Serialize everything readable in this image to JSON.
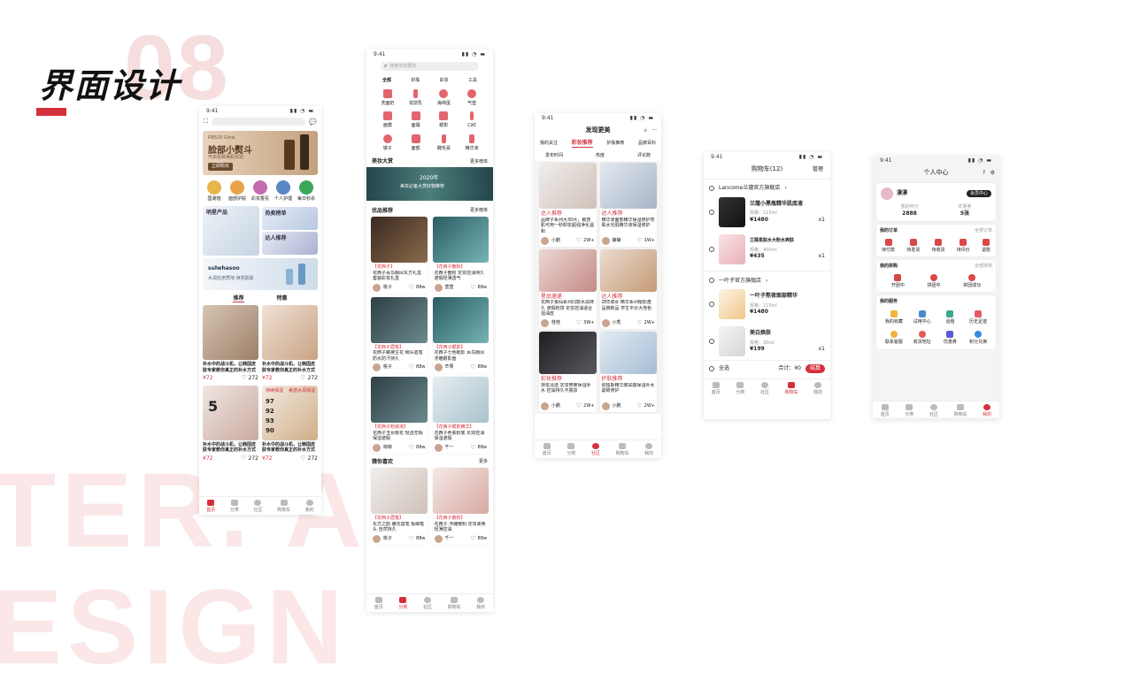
{
  "header": {
    "title": "界面设计",
    "number": "08",
    "watermark_1": "TER. AI",
    "watermark_2": "ESIGN"
  },
  "colors": {
    "accent": "#d4303c",
    "watermark": "#fbe7e7"
  },
  "p1": {
    "time": "9:41",
    "banner_tag": "RB520 Glow",
    "banner_title": "脸部小熨斗",
    "banner_sub": "开启极致美肌体验",
    "banner_btn": "立即购买",
    "cats": [
      "国潮馆",
      "面部护肤",
      "彩妆香氛",
      "个人护理",
      "每日秒杀"
    ],
    "promo_left": "明星产品",
    "promo_hot": "热卖榜单",
    "promo_kol": "达人推荐",
    "brand_name": "sulwhasoo",
    "brand_sub": "水润抗老质地 焕亮肌肤",
    "tabs": [
      "推荐",
      "特惠"
    ],
    "products": [
      {
        "title": "补水中的战斗机，让韩国皮肤专家教你真正的补水方式",
        "price": "¥72",
        "likes": "272"
      },
      {
        "title": "补水中的战斗机，让韩国皮肤专家教你真正的补水方式",
        "price": "¥72",
        "likes": "272"
      },
      {
        "title": "补水中的战斗机，让韩国皮肤专家教你真正的补水方式",
        "price": "¥72",
        "likes": "272"
      },
      {
        "title": "补水中的战斗机，让韩国皮肤专家教你真正的补水方式",
        "price": "¥72",
        "likes": "272"
      }
    ],
    "img2_lines": [
      "持续保湿",
      "美透水润保湿"
    ],
    "img2_nums": [
      "97",
      "92",
      "93",
      "90"
    ],
    "img1_num": "5",
    "nav": [
      "首页",
      "分类",
      "社区",
      "购物车",
      "我的"
    ]
  },
  "p2": {
    "time": "9:41",
    "search_placeholder": "搜索你想要的",
    "tabs": [
      "全部",
      "护肤",
      "彩妆",
      "工具"
    ],
    "icons": [
      "洗面奶",
      "妆前乳",
      "海绵蛋",
      "气垫",
      "面膜",
      "面霜",
      "眼影",
      "口红",
      "镜子",
      "面部",
      "睫毛膏",
      "精华液"
    ],
    "section_contest": "美妆大赏",
    "section_more": "更多榜单",
    "banner_year": "2020年",
    "banner_text": "美妆必备大赏好物推荐",
    "section_picks": "优品推荐",
    "picks_more": "更多榜单",
    "posts": [
      {
        "tag": "【花西子】",
        "text": "花西子百鸟朝凤东方礼盒套装彩妆礼盒",
        "user": "桃子",
        "likes": "88w"
      },
      {
        "tag": "【花西子散粉】",
        "text": "花西子散粉 定妆控油持久遮瑕轻薄透气",
        "user": "萱萱",
        "likes": "88w"
      },
      {
        "tag": "【花西子眉笔】",
        "text": "花西子螺黛生花 细头眉笔防水防汗持久",
        "user": "桃子",
        "likes": "88w"
      },
      {
        "tag": "【花西子眼影】",
        "text": "花西子七色眼影 百鸟朝凤浮雕眼影盘",
        "user": "芒果",
        "likes": "88w"
      },
      {
        "tag": "【花西子粉底液】",
        "text": "花西子玉女桃花 轻透无瑕 保湿遮瑕",
        "user": "柳柳",
        "likes": "88w"
      },
      {
        "tag": "【花西子眼影精华】",
        "text": "花西子养肤粉底 长效控油 保湿遮瑕",
        "user": "千一",
        "likes": "88w"
      },
      {
        "tag": "【花西子眉笔】",
        "text": "东方之韵 雕花眉笔 极细笔头 自然持久",
        "user": "桃子",
        "likes": "88w"
      },
      {
        "tag": "【花西子散粉】",
        "text": "花西子 浮雕散粉 定妆柔焦 轻薄控油",
        "user": "千一",
        "likes": "88w"
      }
    ],
    "section_guess": "猜你喜欢",
    "guess_more": "更多",
    "nav": [
      "首页",
      "分类",
      "社区",
      "购物车",
      "我的"
    ]
  },
  "p3": {
    "time": "9:41",
    "title": "发现更美",
    "tabs": [
      "我的关注",
      "彩妆推荐",
      "护肤推荐",
      "品牌百科"
    ],
    "filters": [
      "发布时间",
      "热度",
      "评论数"
    ],
    "posts": [
      {
        "tag": "达人推荐",
        "text": "品牌子系列大30片，敏感肌可用一秒卸妆超强净化温和",
        "user": "小鹏",
        "likes": "2W+"
      },
      {
        "tag": "达人推荐",
        "text": "精华液面部精华保湿修护亮肤水光肌精华液保湿修护",
        "user": "静静",
        "likes": "1W+"
      },
      {
        "tag": "星品速递",
        "text": "花西子兔仙系列同款水润持久 遮瑕粉饼 定妆控油适合混油皮",
        "user": "桂桂",
        "likes": "3W+"
      },
      {
        "tag": "达人推荐",
        "text": "ZEE淑女 精华系列眼影盘 品牌新品 学生平价大地色",
        "user": "小秀",
        "likes": "2W+"
      },
      {
        "tag": "彩妆推荐",
        "text": "持妆清透 定妆喷雾保湿补水 控油持久不脱妆",
        "user": "小鹏",
        "likes": "2W+"
      },
      {
        "tag": "护肤推荐",
        "text": "依帕斯精华玻尿酸保湿补水 紧致修护",
        "user": "小鹏",
        "likes": "2W+"
      }
    ],
    "nav": [
      "首页",
      "分类",
      "社区",
      "购物车",
      "我的"
    ]
  },
  "p4": {
    "time": "9:41",
    "title": "购物车(12)",
    "manage": "管理",
    "store1": "Lancome兰蔻官方旗舰店",
    "store2": "一叶子官方旗舰店",
    "items": [
      {
        "name": "兰蔻小黑瓶精华肌底液",
        "spec": "规格：115ml",
        "price": "¥1480",
        "qty": "x1"
      },
      {
        "name": "兰蔻柔肤水大粉水爽肤",
        "spec": "规格：400ml",
        "price": "¥435",
        "qty": "x1"
      },
      {
        "name": "一叶子熬夜面部精华",
        "spec": "规格：115ml",
        "price": "¥1480",
        "qty": "x1"
      },
      {
        "name": "美白焕肤",
        "spec": "规格：30ml",
        "price": "¥199",
        "qty": "x1"
      }
    ],
    "select_all": "全选",
    "total": "合计：¥0",
    "checkout": "结算",
    "nav": [
      "首页",
      "分类",
      "社区",
      "购物车",
      "我的"
    ]
  },
  "p5": {
    "time": "9:41",
    "title": "个人中心",
    "username": "漂漂",
    "member_btn": "会员中心",
    "stat1_label": "我的积分",
    "stat1_value": "2888",
    "stat2_label": "优惠券",
    "stat2_value": "5张",
    "orders_title": "我的订单",
    "orders_more": "全部订单",
    "orders": [
      "待付款",
      "待发货",
      "待收货",
      "待评价",
      "退款"
    ],
    "logistics_title": "我的拼购",
    "logistics_more": "全部拼购",
    "logistics": [
      "开团中",
      "拼团中",
      "拼团成功"
    ],
    "services_title": "我的服务",
    "services": [
      "我的收藏",
      "试用中心",
      "话题",
      "历史足迹",
      "联系客服",
      "收货地址",
      "优惠券",
      "积分兑换"
    ],
    "nav": [
      "首页",
      "分类",
      "社区",
      "购物车",
      "我的"
    ]
  }
}
